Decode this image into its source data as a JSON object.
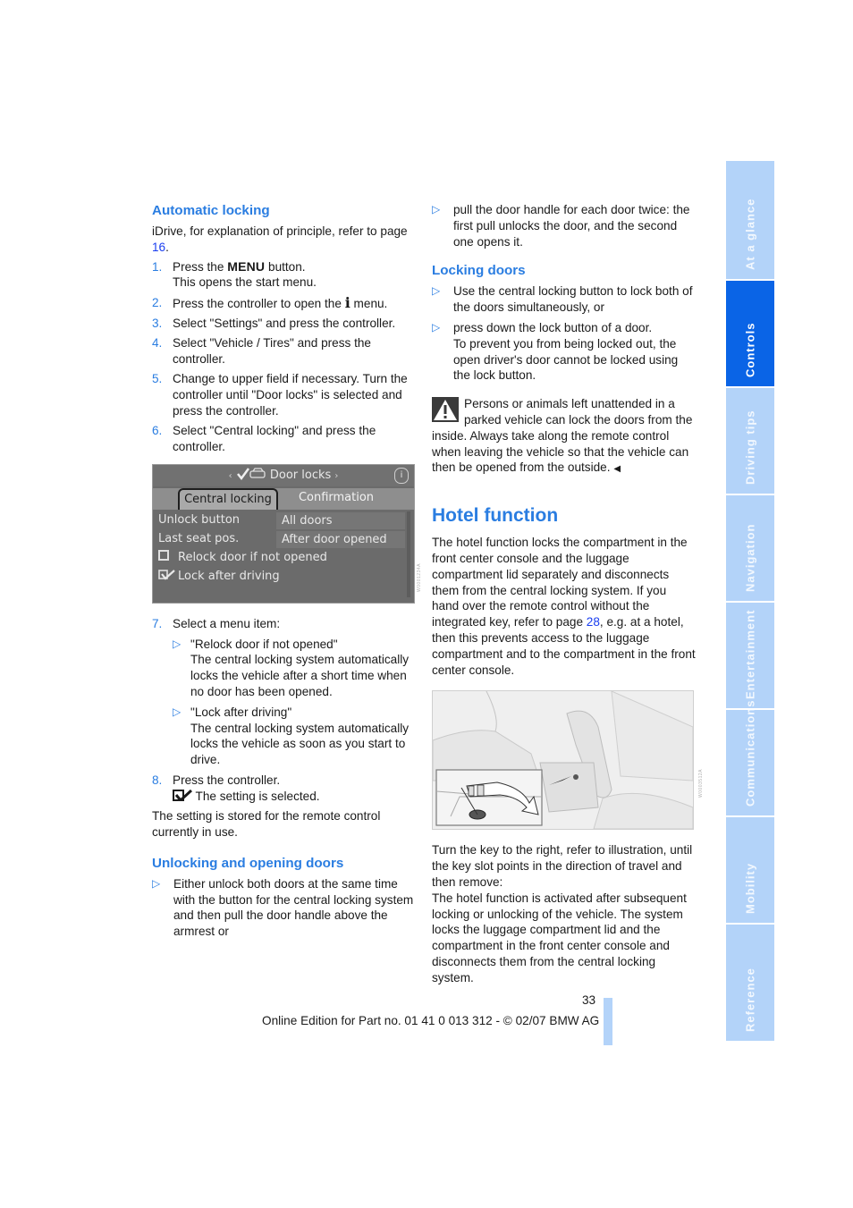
{
  "left": {
    "automatic_locking": {
      "heading": "Automatic locking",
      "intro_before": "iDrive, for explanation of principle, refer to page ",
      "intro_link": "16",
      "intro_after": ".",
      "steps": [
        {
          "num": "1.",
          "pre": "Press the ",
          "menu_word": "MENU",
          "post": " button.",
          "line2": "This opens the start menu."
        },
        {
          "num": "2.",
          "pre": "Press the controller to open the ",
          "icon_glyph": "i",
          "post": " menu."
        },
        {
          "num": "3.",
          "text": "Select \"Settings\" and press the controller."
        },
        {
          "num": "4.",
          "text": "Select \"Vehicle / Tires\" and press the controller."
        },
        {
          "num": "5.",
          "text": "Change to upper field if necessary. Turn the controller until \"Door locks\" is selected and press the controller."
        },
        {
          "num": "6.",
          "text": "Select \"Central locking\" and press the controller."
        }
      ]
    },
    "idrive_screen": {
      "title": "Door locks",
      "nav_left": "‹",
      "nav_right": "›",
      "tabs": [
        "Central locking",
        "Confirmation"
      ],
      "rows": [
        {
          "label": "Unlock button",
          "value": "All doors"
        },
        {
          "label": "Last seat pos.",
          "value": "After door opened"
        }
      ],
      "options": [
        {
          "label": "Relock door if not opened",
          "checked": false
        },
        {
          "label": "Lock after driving",
          "checked": true
        }
      ]
    },
    "step7": {
      "num": "7.",
      "text": "Select a menu item:",
      "items": [
        {
          "title": "\"Relock door if not opened\"",
          "desc": "The central locking system automatically locks the vehicle after a short time when no door has been opened."
        },
        {
          "title": "\"Lock after driving\"",
          "desc": "The central locking system automatically locks the vehicle as soon as you start to drive."
        }
      ]
    },
    "step8": {
      "num": "8.",
      "text": "Press the controller.",
      "confirm": "The setting is selected."
    },
    "stored_note": "The setting is stored for the remote control currently in use.",
    "unlocking": {
      "heading": "Unlocking and opening doors",
      "bullets": [
        "Either unlock both doors at the same time with the button for the central locking system and then pull the door handle above the armrest or"
      ]
    }
  },
  "right": {
    "unlocking_cont": "pull the door handle for each door twice: the first pull unlocks the door, and the second one opens it.",
    "locking": {
      "heading": "Locking doors",
      "bullets": [
        {
          "text": "Use the central locking button to lock both of the doors simultaneously, or"
        },
        {
          "text": "press down the lock button of a door.",
          "extra": "To prevent you from being locked out, the open driver's door cannot be locked using the lock button."
        }
      ]
    },
    "warning": "Persons or animals left unattended in a parked vehicle can lock the doors from the inside. Always take along the remote control when leaving the vehicle so that the vehicle can then be opened from the outside.",
    "warning_end": "◀",
    "hotel": {
      "heading": "Hotel function",
      "para1_before": "The hotel function locks the compartment in the front center console and the luggage compartment lid separately and disconnects them from the central locking system. If you hand over the remote control without the integrated key, refer to page ",
      "para1_link": "28",
      "para1_after": ", e.g. at a hotel, then this prevents access to the luggage compartment and to the compartment in the front center console.",
      "para2": "Turn the key to the right, refer to illustration, until the key slot points in the direction of travel and then remove:",
      "para3": "The hotel function is activated after subsequent locking or unlocking of the vehicle. The system locks the luggage compartment lid and the compartment in the front center console and disconnects them from the central locking system."
    }
  },
  "side_tabs": [
    {
      "label": "At a glance",
      "active": false
    },
    {
      "label": "Controls",
      "active": true
    },
    {
      "label": "Driving tips",
      "active": false
    },
    {
      "label": "Navigation",
      "active": false
    },
    {
      "label": "Entertainment",
      "active": false
    },
    {
      "label": "Communications",
      "active": false
    },
    {
      "label": "Mobility",
      "active": false
    },
    {
      "label": "Reference",
      "active": false
    }
  ],
  "footer": {
    "page_number": "33",
    "edition": "Online Edition for Part no. 01 41 0 013 312 - © 02/07 BMW AG"
  },
  "colors": {
    "heading_blue": "#2a7de1",
    "link_blue": "#1a3ef0",
    "tab_light": "#b3d3f9",
    "tab_active": "#0a64e6"
  }
}
